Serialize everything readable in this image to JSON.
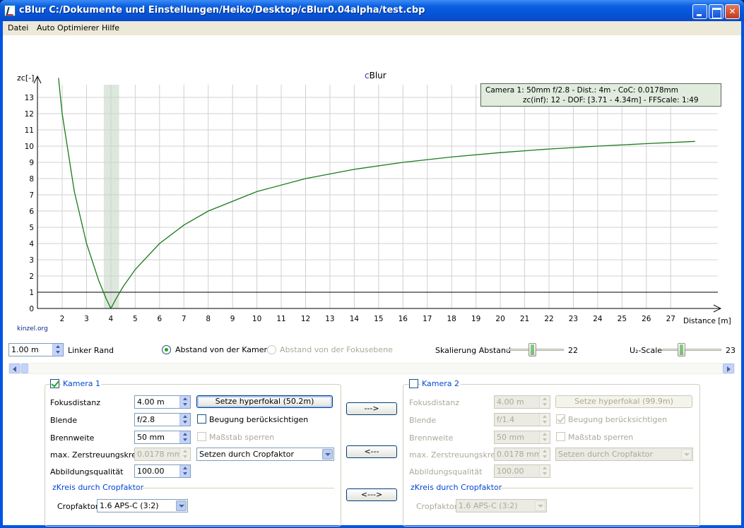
{
  "window": {
    "title": "cBlur C:/Dokumente und Einstellungen/Heiko/Desktop/cBlur0.04alpha/test.cbp",
    "minimize_icon": "minimize-icon",
    "maximize_icon": "maximize-icon",
    "close_icon": "close-icon"
  },
  "menu": {
    "items": [
      "Datei",
      "Auto Optimierer",
      "Hilfe"
    ]
  },
  "chart": {
    "title": "cBlur",
    "title_prefix": "c",
    "title_rest": "Blur",
    "ylabel": "zc[-]",
    "xlabel": "Distance [m]",
    "watermark": "kinzel.org",
    "info_line1": "Camera 1: 50mm f/2.8 - Dist.: 4m - CoC: 0.0178mm",
    "info_line2": "zc(inf): 12 - DOF: [3.71 - 4.34m] - FFScale: 1:49",
    "colors": {
      "curve": "#1a7a1a",
      "dof_band": "#dde8dc",
      "grid": "#d0d0d0",
      "title_c": "#3030c0"
    }
  },
  "chart_data": {
    "type": "line",
    "title": "cBlur",
    "xlabel": "Distance [m]",
    "ylabel": "zc[-]",
    "xlim": [
      1.0,
      28.0
    ],
    "ylim": [
      0,
      14
    ],
    "x_ticks": [
      2,
      3,
      4,
      5,
      6,
      7,
      8,
      9,
      10,
      11,
      12,
      13,
      14,
      15,
      16,
      17,
      18,
      19,
      20,
      21,
      22,
      23,
      24,
      25,
      26,
      27
    ],
    "y_ticks": [
      0,
      1,
      2,
      3,
      4,
      5,
      6,
      7,
      8,
      9,
      10,
      11,
      12,
      13
    ],
    "grid": true,
    "series": [
      {
        "x": [
          1.85,
          2.0,
          2.5,
          3.0,
          3.5,
          3.8,
          4.0,
          4.2,
          4.5,
          5.0,
          6.0,
          7.0,
          8.0,
          10.0,
          12.0,
          14.0,
          16.0,
          18.0,
          20.0,
          22.0,
          24.0,
          26.0,
          28.0
        ],
        "y": [
          14.2,
          12.0,
          7.2,
          4.0,
          1.72,
          0.63,
          0.0,
          0.57,
          1.33,
          2.4,
          4.0,
          5.14,
          6.0,
          7.2,
          8.0,
          8.57,
          9.0,
          9.33,
          9.6,
          9.82,
          10.0,
          10.15,
          10.29
        ]
      }
    ],
    "reference_line_y": 1,
    "dof_band": [
      3.71,
      4.34
    ]
  },
  "controls": {
    "left_edge_value": "1.00 m",
    "left_edge_label": "Linker Rand",
    "radio_camera_label": "Abstand von der Kamera",
    "radio_focus_label": "Abstand von der Fokusebene",
    "scale_distance_label": "Skalierung Abstand",
    "scale_distance_value": "22",
    "scale_distance_fraction": 0.45,
    "uscale_label": "U₂-Scale",
    "uscale_value": "23",
    "uscale_fraction": 0.3
  },
  "camera1": {
    "title": "Kamera 1",
    "focus_label": "Fokusdistanz",
    "focus_value": "4.00 m",
    "hyperfocal_button": "Setze hyperfokal (50.2m)",
    "aperture_label": "Blende",
    "aperture_value": "f/2.8",
    "diffraction_label": "Beugung berücksichtigen",
    "focal_label": "Brennweite",
    "focal_value": "50 mm",
    "lock_scale_label": "Maßstab sperren",
    "coc_label": "max. Zerstreuungskreis",
    "coc_value": "0.0178 mm",
    "coc_mode": "Setzen durch Cropfaktor",
    "quality_label": "Abbildungsqualität",
    "quality_value": "100.00",
    "crop_section_title": "zKreis durch Cropfaktor",
    "crop_label": "Cropfaktor",
    "crop_value": "1.6 APS-C (3:2)"
  },
  "transfer": {
    "copy_right": "--->",
    "copy_left": "<---",
    "swap": "<--->"
  },
  "camera2": {
    "title": "Kamera 2",
    "focus_label": "Fokusdistanz",
    "focus_value": "4.00 m",
    "hyperfocal_button": "Setze hyperfokal (99.9m)",
    "aperture_label": "Blende",
    "aperture_value": "f/1.4",
    "diffraction_label": "Beugung berücksichtigen",
    "focal_label": "Brennweite",
    "focal_value": "50 mm",
    "lock_scale_label": "Maßstab sperren",
    "coc_label": "max. Zerstreuungskreis",
    "coc_value": "0.0178 mm",
    "coc_mode": "Setzen durch Cropfaktor",
    "quality_label": "Abbildungsqualität",
    "quality_value": "100.00",
    "crop_section_title": "zKreis durch Cropfaktor",
    "crop_label": "Cropfaktor",
    "crop_value": "1.6 APS-C (3:2)"
  }
}
